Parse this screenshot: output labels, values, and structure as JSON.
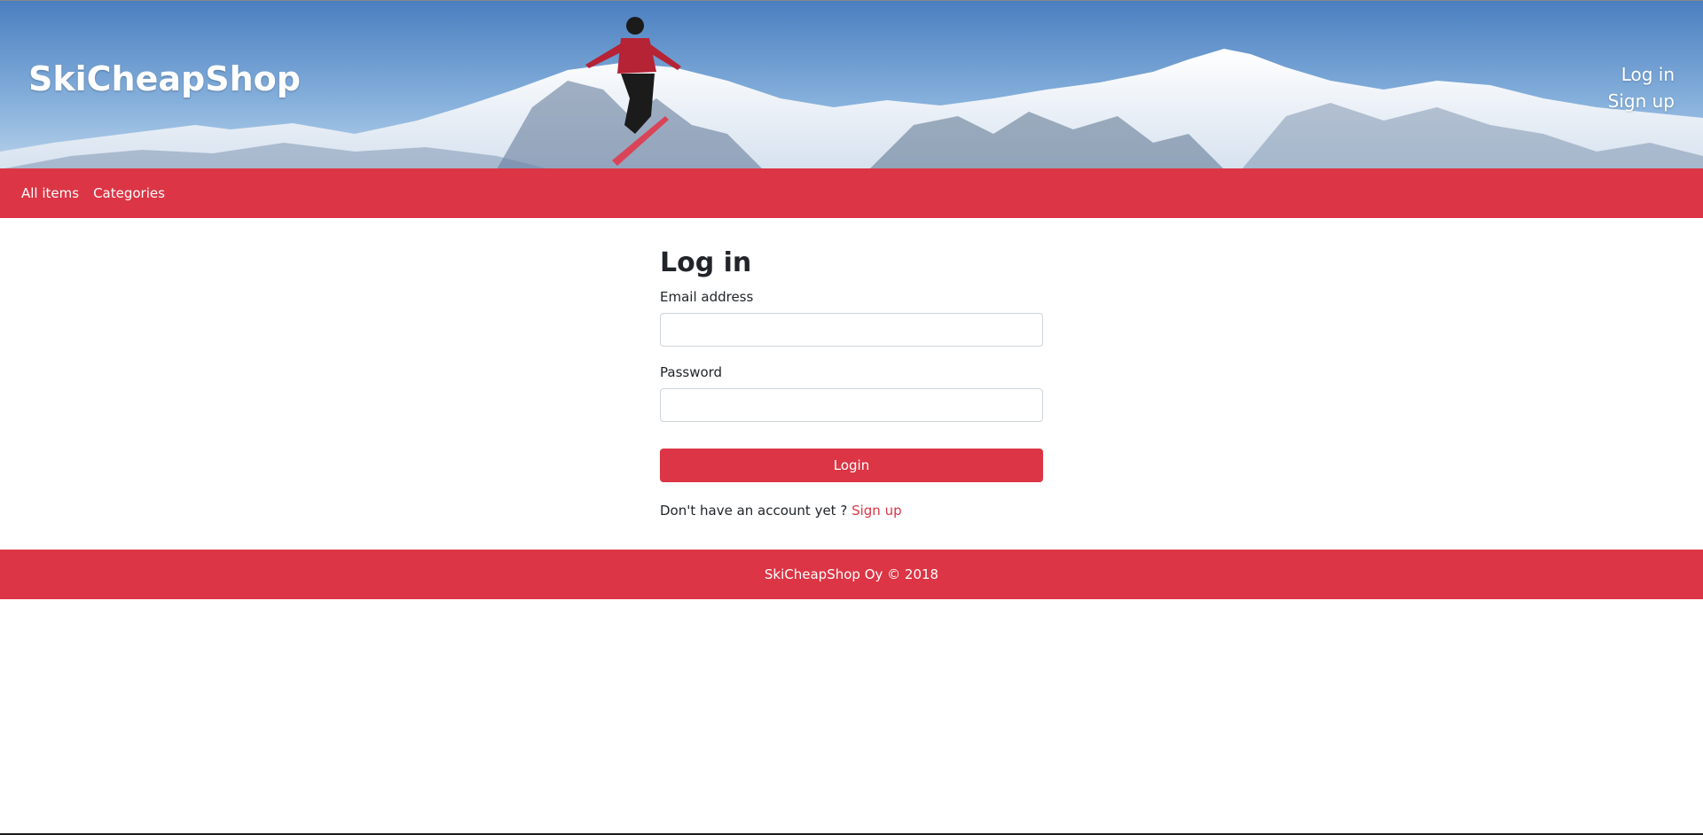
{
  "header": {
    "brand": "SkiCheapShop",
    "login_link": "Log in",
    "signup_link": "Sign up"
  },
  "nav": {
    "items": [
      {
        "label": "All items"
      },
      {
        "label": "Categories"
      }
    ]
  },
  "login_form": {
    "title": "Log in",
    "email_label": "Email address",
    "email_value": "",
    "password_label": "Password",
    "password_value": "",
    "submit_label": "Login",
    "signup_prompt": "Don't have an account yet ?",
    "signup_link": "Sign up"
  },
  "footer": {
    "text": "SkiCheapShop Oy © 2018"
  },
  "colors": {
    "accent": "#dc3545",
    "sky_top": "#4f86c6",
    "sky_bottom": "#a9c8e6",
    "snow": "#f4f7fb",
    "rock": "#3e5573"
  },
  "icons": {
    "header_image": "skier-mountains-banner"
  }
}
